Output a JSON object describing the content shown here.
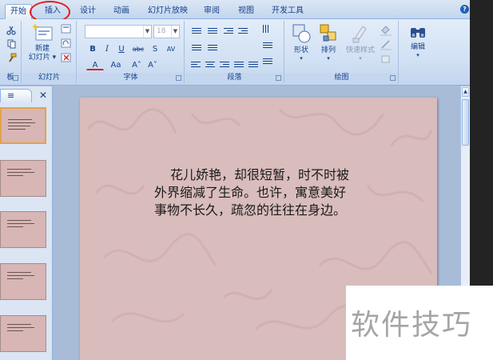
{
  "tabs": [
    {
      "label": "开始",
      "active": true
    },
    {
      "label": "插入",
      "active": false,
      "highlighted": true
    },
    {
      "label": "设计",
      "active": false
    },
    {
      "label": "动画",
      "active": false
    },
    {
      "label": "幻灯片放映",
      "active": false
    },
    {
      "label": "审阅",
      "active": false
    },
    {
      "label": "视图",
      "active": false
    },
    {
      "label": "开发工具",
      "active": false
    }
  ],
  "help_label": "?",
  "ribbon": {
    "groups": {
      "clipboard": "板",
      "slides": "幻灯片",
      "font": "字体",
      "paragraph": "段落",
      "drawing": "绘图"
    },
    "new_slide_line1": "新建",
    "new_slide_line2": "幻灯片",
    "font_name_value": "",
    "font_size_value": "18",
    "format_buttons": [
      "B",
      "I",
      "U",
      "abc",
      "S",
      "AV"
    ],
    "font_row3": [
      "A",
      "Aa",
      "A˄",
      "A˅"
    ],
    "shapes_label": "形状",
    "arrange_label": "排列",
    "quick_styles_label": "快速样式",
    "editing_label": "编辑"
  },
  "panel": {
    "tab_icon": "≡",
    "close_label": "✕"
  },
  "slide": {
    "text": "花儿娇艳，却很短暂，时不时被外界缩减了生命。也许，寓意美好事物不长久，疏忽的往往在身边。"
  },
  "watermark": "软件技巧",
  "colors": {
    "ribbon_text": "#15428b",
    "highlight_circle": "#e0201c",
    "slide_bg": "#d9bcbc",
    "selected_thumb_border": "#e3a24a"
  }
}
